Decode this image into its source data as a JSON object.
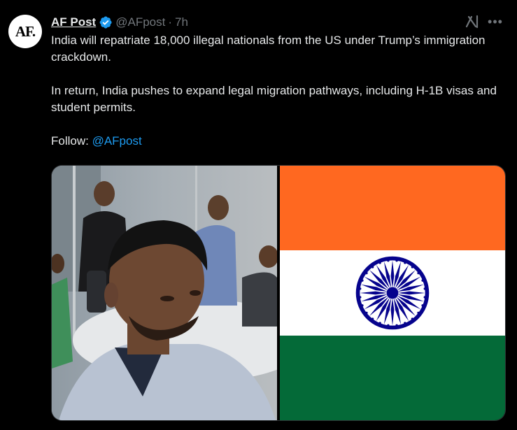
{
  "post": {
    "avatar_text": "AF.",
    "author_name": "AF Post",
    "handle": "@AFpost",
    "separator": "·",
    "time": "7h",
    "paragraph1": "India will repatriate 18,000 illegal nationals from the US under Trump’s immigration crackdown.",
    "paragraph2": "In return, India pushes to expand legal migration pathways, including H-1B visas and student permits.",
    "follow_label": "Follow: ",
    "follow_mention": "@AFpost"
  },
  "icons": {
    "verified": "verified-badge-icon",
    "grok": "grok-icon",
    "more": "more-icon"
  },
  "media": {
    "images": [
      "photo-of-men-in-office",
      "india-flag"
    ]
  },
  "colors": {
    "background": "#000000",
    "text": "#e7e9ea",
    "muted": "#71767b",
    "link": "#1d9bf0",
    "verified": "#1d9bf0",
    "flag_saffron": "#ff6820",
    "flag_white": "#ffffff",
    "flag_green": "#046a38",
    "chakra_blue": "#06038d"
  }
}
